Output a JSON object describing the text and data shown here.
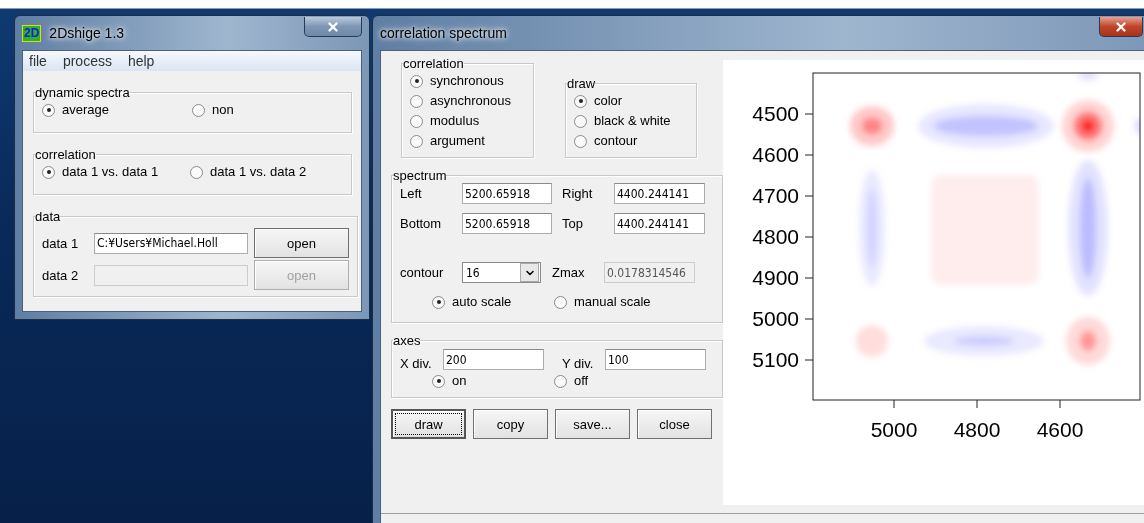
{
  "main_window": {
    "title": "2Dshige 1.3",
    "app_icon_text": "2D",
    "menu": [
      "file",
      "process",
      "help"
    ],
    "groups": [
      {
        "title": "dynamic spectra",
        "options": [
          {
            "label": "average",
            "selected": true
          },
          {
            "label": "non",
            "selected": false
          }
        ]
      },
      {
        "title": "correlation",
        "options": [
          {
            "label": "data 1 vs. data 1",
            "selected": true
          },
          {
            "label": "data 1 vs. data 2",
            "selected": false
          }
        ]
      }
    ],
    "data": {
      "title": "data",
      "rows": [
        {
          "label": "data 1",
          "value": "C:¥Users¥Michael.Holl",
          "disabled": false,
          "button": "open"
        },
        {
          "label": "data 2",
          "disabled": true,
          "button": "open"
        }
      ]
    }
  },
  "spectrum_window": {
    "title": "correlation spectrum",
    "correlation": {
      "title": "correlation",
      "options": [
        {
          "label": "synchronous",
          "selected": true
        },
        {
          "label": "asynchronous",
          "selected": false
        },
        {
          "label": "modulus",
          "selected": false
        },
        {
          "label": "argument",
          "selected": false
        }
      ]
    },
    "draw": {
      "title": "draw",
      "options": [
        {
          "label": "color",
          "selected": true
        },
        {
          "label": "black & white",
          "selected": false
        },
        {
          "label": "contour",
          "selected": false
        }
      ]
    },
    "spectrum": {
      "title": "spectrum",
      "fields": [
        {
          "label": "Left",
          "value": "5200.65918"
        },
        {
          "label": "Right",
          "value": "4400.244141"
        },
        {
          "label": "Bottom",
          "value": "5200.65918"
        },
        {
          "label": "Top",
          "value": "4400.244141"
        }
      ],
      "contour": {
        "label": "contour",
        "value": "16"
      },
      "zmax": {
        "label": "Zmax",
        "value": "0.0178314546",
        "disabled": true
      },
      "scale_options": [
        {
          "label": "auto scale",
          "selected": true
        },
        {
          "label": "manual scale",
          "selected": false
        }
      ]
    },
    "axes": {
      "title": "axes",
      "fields": [
        {
          "label": "X div.",
          "value": "200"
        },
        {
          "label": "Y div.",
          "value": "100"
        }
      ],
      "options": [
        {
          "label": "on",
          "selected": true
        },
        {
          "label": "off",
          "selected": false
        }
      ]
    },
    "buttons": [
      {
        "label": "draw",
        "focused": true
      },
      {
        "label": "copy",
        "focused": false
      },
      {
        "label": "save...",
        "focused": false
      },
      {
        "label": "close",
        "focused": false
      }
    ],
    "plot": {
      "y_tick_labels": [
        "4500",
        "4600",
        "4700",
        "4800",
        "4900",
        "5000",
        "5100"
      ],
      "x_tick_labels": [
        "5000",
        "4800",
        "4600"
      ]
    }
  }
}
